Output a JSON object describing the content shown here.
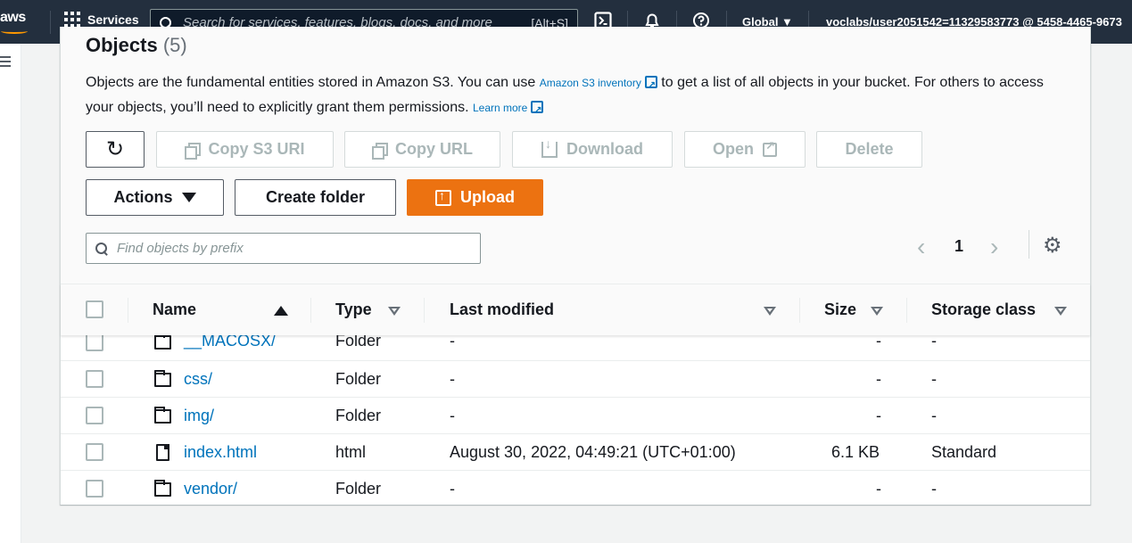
{
  "topbar": {
    "logo_text": "aws",
    "services_label": "Services",
    "search_placeholder": "Search for services, features, blogs, docs, and more",
    "search_shortcut": "[Alt+S]",
    "region_label": "Global ▼",
    "account_label": "voclabs/user2051542=11329583773 @ 5458-4465-9673"
  },
  "objects": {
    "title": "Objects",
    "count": "(5)",
    "description_1": "Objects are the fundamental entities stored in Amazon S3. You can use ",
    "inventory_link": "Amazon S3 inventory",
    "description_2": " to get a list of all objects in your bucket. For others to access your objects, you’ll need to explicitly grant them permissions. ",
    "learn_more": "Learn more"
  },
  "toolbar": {
    "refresh_glyph": "↻",
    "copy_s3_uri": "Copy S3 URI",
    "copy_url": "Copy URL",
    "download": "Download",
    "open": "Open",
    "delete": "Delete",
    "actions": "Actions",
    "create_folder": "Create folder",
    "upload": "Upload"
  },
  "filter": {
    "placeholder": "Find objects by prefix"
  },
  "pagination": {
    "prev": "‹",
    "page": "1",
    "next": "›",
    "settings_glyph": "⚙"
  },
  "table": {
    "headers": {
      "name": "Name",
      "type": "Type",
      "last_modified": "Last modified",
      "size": "Size",
      "storage_class": "Storage class"
    },
    "rows": [
      {
        "icon": "folder",
        "name": "__MACOSX/",
        "type": "Folder",
        "last_modified": "-",
        "size": "-",
        "storage_class": "-"
      },
      {
        "icon": "folder",
        "name": "css/",
        "type": "Folder",
        "last_modified": "-",
        "size": "-",
        "storage_class": "-"
      },
      {
        "icon": "folder",
        "name": "img/",
        "type": "Folder",
        "last_modified": "-",
        "size": "-",
        "storage_class": "-"
      },
      {
        "icon": "file",
        "name": "index.html",
        "type": "html",
        "last_modified": "August 30, 2022, 04:49:21 (UTC+01:00)",
        "size": "6.1 KB",
        "storage_class": "Standard"
      },
      {
        "icon": "folder",
        "name": "vendor/",
        "type": "Folder",
        "last_modified": "-",
        "size": "-",
        "storage_class": "-"
      }
    ]
  },
  "colors": {
    "nav_bg": "#232f3e",
    "accent": "#ec7211",
    "link": "#0073bb"
  }
}
